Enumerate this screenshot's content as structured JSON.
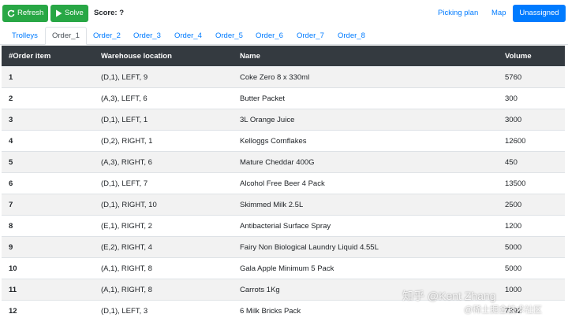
{
  "toolbar": {
    "refresh_label": "Refresh",
    "solve_label": "Solve",
    "score_label": "Score: ?",
    "picking_plan_label": "Picking plan",
    "map_label": "Map",
    "unassigned_label": "Unassigned",
    "colors": {
      "green": "#28a745",
      "blue": "#007bff"
    }
  },
  "tabs": [
    "Trolleys",
    "Order_1",
    "Order_2",
    "Order_3",
    "Order_4",
    "Order_5",
    "Order_6",
    "Order_7",
    "Order_8"
  ],
  "active_tab": "Order_1",
  "table": {
    "headers": [
      "#Order item",
      "Warehouse location",
      "Name",
      "Volume"
    ],
    "rows": [
      [
        "1",
        "(D,1), LEFT, 9",
        "Coke Zero 8 x 330ml",
        "5760"
      ],
      [
        "2",
        "(A,3), LEFT, 6",
        "Butter Packet",
        "300"
      ],
      [
        "3",
        "(D,1), LEFT, 1",
        "3L Orange Juice",
        "3000"
      ],
      [
        "4",
        "(D,2), RIGHT, 1",
        "Kelloggs Cornflakes",
        "12600"
      ],
      [
        "5",
        "(A,3), RIGHT, 6",
        "Mature Cheddar 400G",
        "450"
      ],
      [
        "6",
        "(D,1), LEFT, 7",
        "Alcohol Free Beer 4 Pack",
        "13500"
      ],
      [
        "7",
        "(D,1), RIGHT, 10",
        "Skimmed Milk 2.5L",
        "2500"
      ],
      [
        "8",
        "(E,1), RIGHT, 2",
        "Antibacterial Surface Spray",
        "1200"
      ],
      [
        "9",
        "(E,2), RIGHT, 4",
        "Fairy Non Biological Laundry Liquid 4.55L",
        "5000"
      ],
      [
        "10",
        "(A,1), RIGHT, 8",
        "Gala Apple Minimum 5 Pack",
        "5000"
      ],
      [
        "11",
        "(A,1), RIGHT, 8",
        "Carrots 1Kg",
        "1000"
      ],
      [
        "12",
        "(D,1), LEFT, 3",
        "6 Milk Bricks Pack",
        "7392"
      ]
    ]
  },
  "watermark": {
    "line1": "知乎 @Kent Zhang",
    "line2": "@稀土掘金技术社区"
  }
}
